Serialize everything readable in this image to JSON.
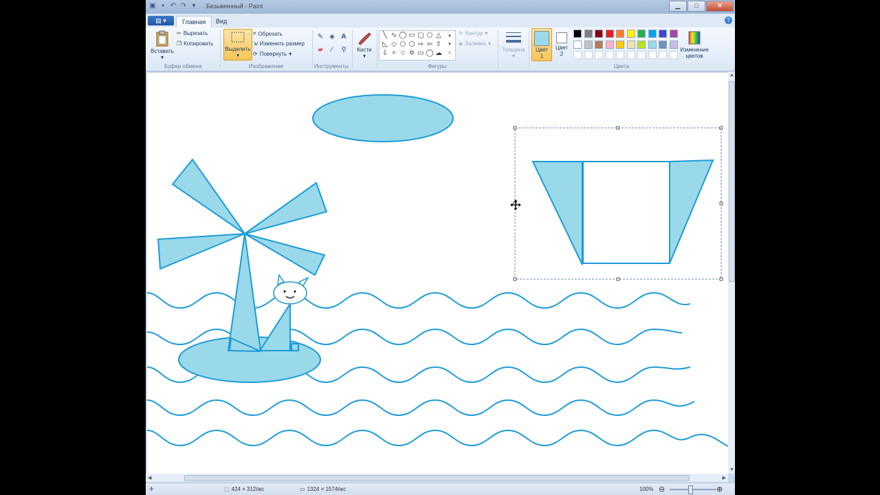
{
  "window": {
    "title": "Безымянный - Paint",
    "controls": {
      "minimize": "▁",
      "maximize": "□",
      "close": "✕"
    }
  },
  "quick_access": [
    "save-icon",
    "undo-icon",
    "redo-icon",
    "customize-icon"
  ],
  "tabs": {
    "file_icon": "▤ ▾",
    "items": [
      {
        "label": "Главная",
        "active": true
      },
      {
        "label": "Вид",
        "active": false
      }
    ]
  },
  "ribbon": {
    "clipboard": {
      "label": "Буфер обмена",
      "paste": "Вставить",
      "cut": "Вырезать",
      "copy": "Копировать"
    },
    "image": {
      "label": "Изображение",
      "select": "Выделить",
      "crop": "Обрезать",
      "resize": "Изменить размер",
      "rotate": "Повернуть"
    },
    "tools": {
      "label": "Инструменты"
    },
    "brushes": {
      "label": "Кисти"
    },
    "shapes": {
      "label": "Фигуры",
      "outline": "Контур",
      "fill": "Заливка"
    },
    "size": {
      "label": "Толщина"
    },
    "colors": {
      "label": "Цвета",
      "color1": "Цвет 1",
      "color2": "Цвет 2",
      "edit": "Изменение цветов",
      "primary": "#99d9ea",
      "secondary": "#ffffff",
      "palette_row1": [
        "#000000",
        "#7f7f7f",
        "#880015",
        "#ed1c24",
        "#ff7f27",
        "#fff200",
        "#22b14c",
        "#00a2e8",
        "#3f48cc",
        "#a349a4"
      ],
      "palette_row2": [
        "#ffffff",
        "#c3c3c3",
        "#b97a57",
        "#ffaec9",
        "#ffc90e",
        "#efe4b0",
        "#b5e61d",
        "#99d9ea",
        "#7092be",
        "#c8bfe7"
      ],
      "palette_row3": [
        "#ffffff",
        "#ffffff",
        "#ffffff",
        "#ffffff",
        "#ffffff",
        "#ffffff",
        "#ffffff",
        "#ffffff",
        "#ffffff",
        "#ffffff"
      ]
    }
  },
  "drawing": {
    "stroke": "#1c9bd8",
    "fill": "#99d9ea"
  },
  "status": {
    "selection_size": "424 × 312пкс",
    "image_size": "1324 × 1574пкс",
    "zoom": "100%"
  }
}
